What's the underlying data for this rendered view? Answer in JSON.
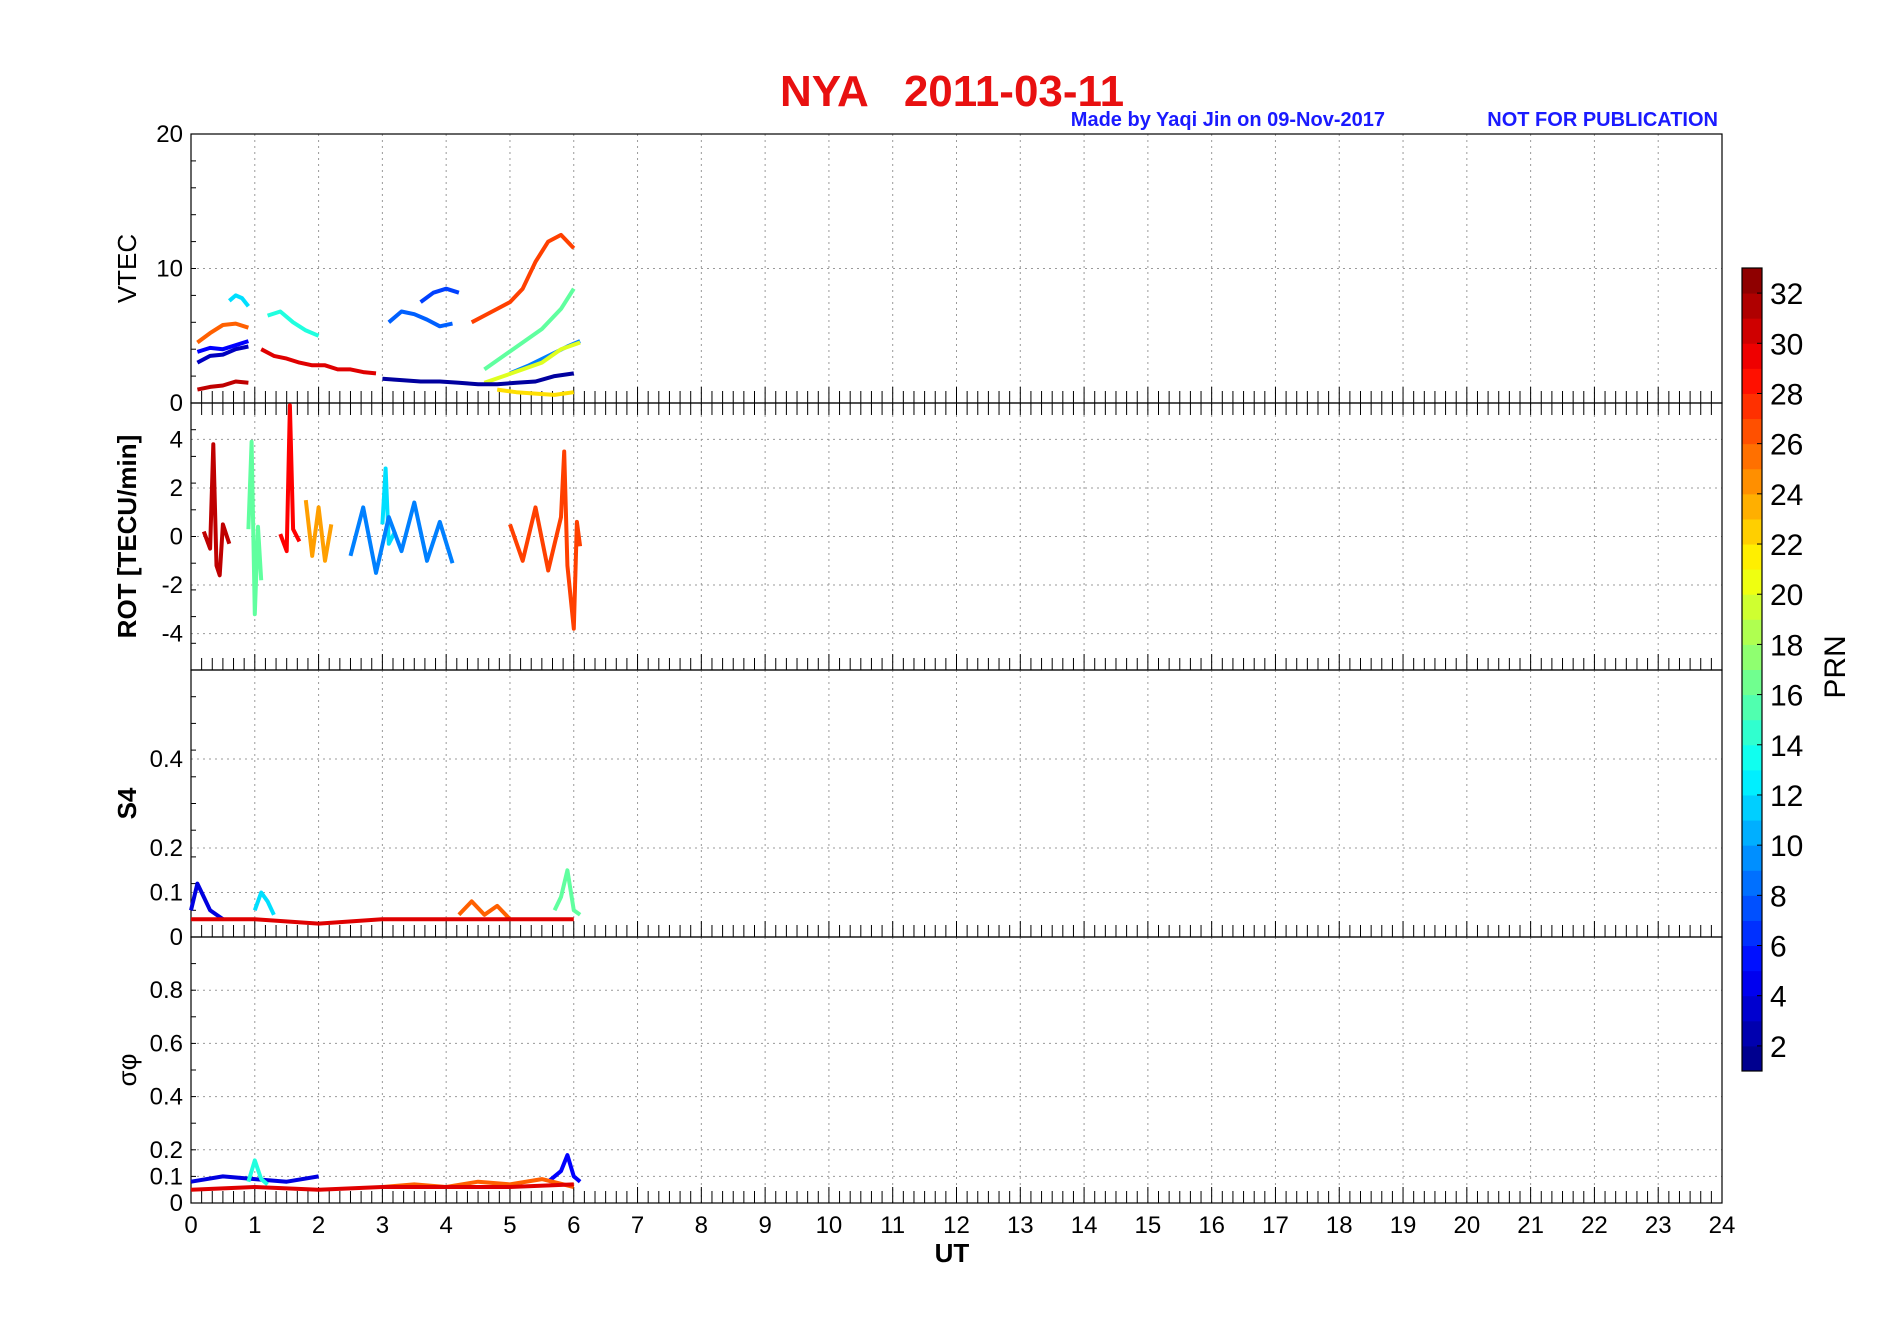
{
  "figure": {
    "title": "NYA   2011-03-11",
    "credit": "Made by Yaqi Jin on 09-Nov-2017",
    "notice": "NOT FOR PUBLICATION",
    "xlabel": "UT",
    "colorbar_label": "PRN",
    "colorbar_ticks": [
      "2",
      "4",
      "6",
      "8",
      "10",
      "12",
      "14",
      "16",
      "18",
      "20",
      "22",
      "24",
      "26",
      "28",
      "30",
      "32"
    ],
    "colorbar_range": [
      1,
      33
    ]
  },
  "chart_data": [
    {
      "type": "line",
      "panel": "vtec",
      "ylabel": "VTEC",
      "ylim": [
        0,
        20
      ],
      "yticks": [
        "0",
        "10",
        "20"
      ],
      "xlim": [
        0,
        24
      ],
      "xticks": [
        "0",
        "1",
        "2",
        "3",
        "4",
        "5",
        "6",
        "7",
        "8",
        "9",
        "10",
        "11",
        "12",
        "13",
        "14",
        "15",
        "16",
        "17",
        "18",
        "19",
        "20",
        "21",
        "22",
        "23",
        "24"
      ],
      "series": [
        {
          "prn": 3,
          "x": [
            0.1,
            0.3,
            0.5,
            0.7,
            0.9
          ],
          "y": [
            3.0,
            3.5,
            3.6,
            4.0,
            4.2
          ]
        },
        {
          "prn": 5,
          "x": [
            0.1,
            0.3,
            0.5,
            0.7,
            0.9
          ],
          "y": [
            3.8,
            4.1,
            4.0,
            4.3,
            4.6
          ]
        },
        {
          "prn": 9,
          "x": [
            5.0,
            5.3,
            5.6,
            5.9,
            6.1
          ],
          "y": [
            2.2,
            2.8,
            3.5,
            4.2,
            4.6
          ]
        },
        {
          "prn": 12,
          "x": [
            0.6,
            0.7,
            0.8,
            0.9
          ],
          "y": [
            7.6,
            8.0,
            7.8,
            7.2
          ]
        },
        {
          "prn": 14,
          "x": [
            1.2,
            1.4,
            1.6,
            1.8,
            2.0
          ],
          "y": [
            6.5,
            6.8,
            6.0,
            5.4,
            5.0
          ]
        },
        {
          "prn": 26,
          "x": [
            0.1,
            0.3,
            0.5,
            0.7,
            0.9
          ],
          "y": [
            4.5,
            5.2,
            5.8,
            5.9,
            5.6
          ]
        },
        {
          "prn": 27,
          "x": [
            4.4,
            4.6,
            4.8,
            5.0,
            5.2,
            5.4,
            5.6,
            5.8,
            6.0
          ],
          "y": [
            6.0,
            6.5,
            7.0,
            7.5,
            8.5,
            10.5,
            12.0,
            12.5,
            11.5
          ]
        },
        {
          "prn": 30,
          "x": [
            1.1,
            1.3,
            1.5,
            1.7,
            1.9,
            2.1,
            2.3,
            2.5,
            2.7,
            2.9
          ],
          "y": [
            4.0,
            3.5,
            3.3,
            3.0,
            2.8,
            2.8,
            2.5,
            2.5,
            2.3,
            2.2
          ]
        },
        {
          "prn": 31,
          "x": [
            0.1,
            0.3,
            0.5,
            0.7,
            0.9
          ],
          "y": [
            1.0,
            1.2,
            1.3,
            1.6,
            1.5
          ]
        },
        {
          "prn": 8,
          "x": [
            3.1,
            3.3,
            3.5,
            3.7,
            3.9,
            4.1
          ],
          "y": [
            6.0,
            6.8,
            6.6,
            6.2,
            5.7,
            5.9
          ]
        },
        {
          "prn": 7,
          "x": [
            3.6,
            3.8,
            4.0,
            4.2
          ],
          "y": [
            7.5,
            8.2,
            8.5,
            8.2
          ]
        },
        {
          "prn": 20,
          "x": [
            4.6,
            4.9,
            5.2,
            5.5,
            5.8,
            6.1
          ],
          "y": [
            1.5,
            2.0,
            2.5,
            3.0,
            4.0,
            4.5
          ]
        },
        {
          "prn": 16,
          "x": [
            4.6,
            4.9,
            5.2,
            5.5,
            5.8,
            6.0
          ],
          "y": [
            2.5,
            3.5,
            4.5,
            5.5,
            7.0,
            8.5
          ]
        },
        {
          "prn": 2,
          "x": [
            3.0,
            3.3,
            3.6,
            3.9,
            4.2,
            4.5,
            4.8,
            5.1,
            5.4,
            5.7,
            6.0
          ],
          "y": [
            1.8,
            1.7,
            1.6,
            1.6,
            1.5,
            1.4,
            1.4,
            1.5,
            1.6,
            2.0,
            2.2
          ]
        },
        {
          "prn": 22,
          "x": [
            4.8,
            5.1,
            5.4,
            5.7,
            6.0
          ],
          "y": [
            1.0,
            0.8,
            0.7,
            0.6,
            0.8
          ]
        }
      ]
    },
    {
      "type": "line",
      "panel": "rot",
      "ylabel": "ROT [TECU/min]",
      "ylim": [
        -5.5,
        5.5
      ],
      "yticks": [
        "-4",
        "-2",
        "0",
        "2",
        "4"
      ],
      "xlim": [
        0,
        24
      ],
      "series": [
        {
          "prn": 31,
          "x": [
            0.2,
            0.3,
            0.35,
            0.4,
            0.45,
            0.5,
            0.6
          ],
          "y": [
            0.2,
            -0.5,
            3.8,
            -1.2,
            -1.6,
            0.5,
            -0.3
          ]
        },
        {
          "prn": 29,
          "x": [
            1.4,
            1.5,
            1.55,
            1.6,
            1.7
          ],
          "y": [
            0.1,
            -0.6,
            5.4,
            0.3,
            -0.2
          ]
        },
        {
          "prn": 16,
          "x": [
            0.9,
            0.95,
            1.0,
            1.05,
            1.1
          ],
          "y": [
            0.3,
            3.9,
            -3.2,
            0.4,
            -1.8
          ]
        },
        {
          "prn": 12,
          "x": [
            3.0,
            3.05,
            3.1,
            3.2
          ],
          "y": [
            0.5,
            2.8,
            -0.3,
            0.2
          ]
        },
        {
          "prn": 9,
          "x": [
            2.5,
            2.7,
            2.9,
            3.1,
            3.3,
            3.5,
            3.7,
            3.9,
            4.1
          ],
          "y": [
            -0.8,
            1.2,
            -1.5,
            0.8,
            -0.6,
            1.4,
            -1.0,
            0.6,
            -1.1
          ]
        },
        {
          "prn": 27,
          "x": [
            5.0,
            5.2,
            5.4,
            5.6,
            5.8,
            5.85,
            5.9,
            6.0,
            6.05,
            6.1
          ],
          "y": [
            0.5,
            -1.0,
            1.2,
            -1.4,
            0.8,
            3.5,
            -1.2,
            -3.8,
            0.6,
            -0.4
          ]
        },
        {
          "prn": 24,
          "x": [
            1.8,
            1.9,
            2.0,
            2.1,
            2.2
          ],
          "y": [
            1.5,
            -0.8,
            1.2,
            -1.0,
            0.5
          ]
        }
      ]
    },
    {
      "type": "line",
      "panel": "s4",
      "ylabel": "S4",
      "ylim": [
        0,
        0.6
      ],
      "yticks": [
        "0",
        "0.1",
        "0.2",
        "0.4"
      ],
      "xlim": [
        0,
        24
      ],
      "series": [
        {
          "prn": 4,
          "x": [
            0.0,
            0.1,
            0.2,
            0.3,
            0.4,
            0.5
          ],
          "y": [
            0.06,
            0.12,
            0.09,
            0.06,
            0.05,
            0.04
          ]
        },
        {
          "prn": 12,
          "x": [
            1.0,
            1.1,
            1.2,
            1.3
          ],
          "y": [
            0.06,
            0.1,
            0.08,
            0.05
          ]
        },
        {
          "prn": 16,
          "x": [
            5.7,
            5.8,
            5.9,
            6.0,
            6.1
          ],
          "y": [
            0.06,
            0.09,
            0.15,
            0.06,
            0.05
          ]
        },
        {
          "prn": 26,
          "x": [
            4.2,
            4.4,
            4.6,
            4.8,
            5.0
          ],
          "y": [
            0.05,
            0.08,
            0.05,
            0.07,
            0.04
          ]
        },
        {
          "prn": 30,
          "x": [
            0.0,
            1.0,
            2.0,
            3.0,
            4.0,
            5.0,
            6.0
          ],
          "y": [
            0.04,
            0.04,
            0.03,
            0.04,
            0.04,
            0.04,
            0.04
          ]
        }
      ]
    },
    {
      "type": "line",
      "panel": "sigma_phi",
      "ylabel": "σφ",
      "ylim": [
        0,
        1
      ],
      "yticks": [
        "0",
        "0.1",
        "0.2",
        "0.4",
        "0.6",
        "0.8"
      ],
      "xlim": [
        0,
        24
      ],
      "series": [
        {
          "prn": 4,
          "x": [
            0.0,
            0.5,
            1.0,
            1.5,
            2.0
          ],
          "y": [
            0.08,
            0.1,
            0.09,
            0.08,
            0.1
          ]
        },
        {
          "prn": 14,
          "x": [
            0.9,
            1.0,
            1.1,
            1.2
          ],
          "y": [
            0.08,
            0.16,
            0.09,
            0.07
          ]
        },
        {
          "prn": 5,
          "x": [
            5.6,
            5.8,
            5.9,
            6.0,
            6.1
          ],
          "y": [
            0.08,
            0.12,
            0.18,
            0.1,
            0.08
          ]
        },
        {
          "prn": 26,
          "x": [
            3.0,
            3.5,
            4.0,
            4.5,
            5.0,
            5.5,
            6.0
          ],
          "y": [
            0.06,
            0.07,
            0.06,
            0.08,
            0.07,
            0.09,
            0.06
          ]
        },
        {
          "prn": 30,
          "x": [
            0.0,
            1.0,
            2.0,
            3.0,
            4.0,
            5.0,
            6.0
          ],
          "y": [
            0.05,
            0.06,
            0.05,
            0.06,
            0.06,
            0.06,
            0.07
          ]
        }
      ]
    }
  ]
}
